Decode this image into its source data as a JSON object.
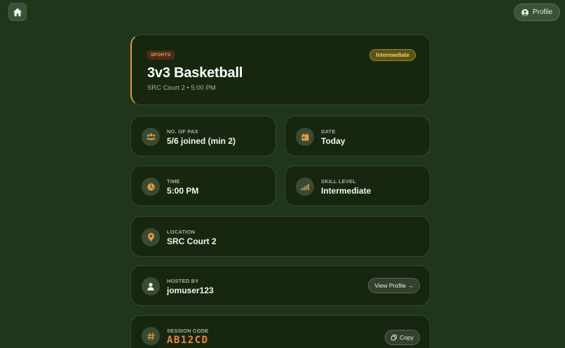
{
  "nav": {
    "profile_label": "Profile"
  },
  "event": {
    "category": "SPORTS",
    "level_badge": "Intermediate",
    "title": "3v3 Basketball",
    "subtitle": "SRC Court 2 • 5:00 PM"
  },
  "details": {
    "pax": {
      "label": "NO. OF PAX",
      "value": "5/6 joined (min 2)",
      "icon": "group-icon"
    },
    "date": {
      "label": "DATE",
      "value": "Today",
      "icon": "calendar-icon"
    },
    "time": {
      "label": "TIME",
      "value": "5:00 PM",
      "icon": "clock-icon"
    },
    "skill": {
      "label": "SKILL LEVEL",
      "value": "Intermediate",
      "icon": "signal-bars-icon"
    },
    "location": {
      "label": "LOCATION",
      "value": "SRC Court 2",
      "icon": "map-pin-icon"
    },
    "host": {
      "label": "HOSTED BY",
      "value": "jomuser123",
      "action": "View Profile →",
      "icon": "user-icon"
    },
    "session": {
      "label": "SESSION CODE",
      "value": "AB12CD",
      "action": "Copy",
      "icon": "hash-icon"
    }
  },
  "colors": {
    "background": "#1f361b",
    "card": "#17270f",
    "accent": "#e3983c",
    "badge": "#f0d45c"
  }
}
